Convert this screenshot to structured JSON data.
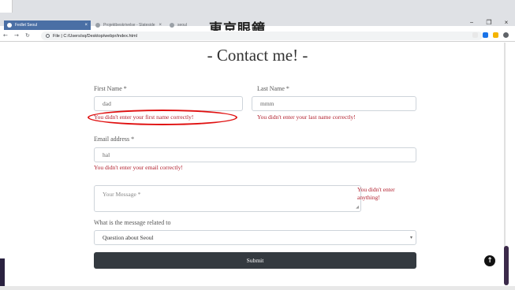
{
  "browser": {
    "tabs": [
      {
        "label": "Fedlet Seoul",
        "active": true
      },
      {
        "label": "Projektbeskrivelse - Slateside",
        "active": false
      },
      {
        "label": "seoul",
        "active": false
      }
    ],
    "overlay_title": "東京眼鏡",
    "address": "File | C:/Users/sq/Desktop/webpr/index.html",
    "window_controls": {
      "minimize": "−",
      "restore": "❐",
      "close": "×"
    }
  },
  "page": {
    "title": "- Contact me! -",
    "first_name": {
      "label": "First Name *",
      "value": "dad",
      "error": "You didn't enter your first name correctly!"
    },
    "last_name": {
      "label": "Last Name *",
      "value": "mmm",
      "error": "You didn't enter your last name correctly!"
    },
    "email": {
      "label": "Email address *",
      "value": "hal",
      "error": "You didn't enter your email correctly!"
    },
    "message": {
      "placeholder": "Your Message *",
      "error": "You didn't enter anything!"
    },
    "related": {
      "label": "What is the message related to",
      "selected": "Question about Seoul"
    },
    "submit_label": "Submit",
    "scroll_top_icon": "↑"
  },
  "colors": {
    "error": "#b01d2b",
    "annotation": "#e01010",
    "submit_bg": "#343a40",
    "active_tab": "#4a6fa5"
  }
}
